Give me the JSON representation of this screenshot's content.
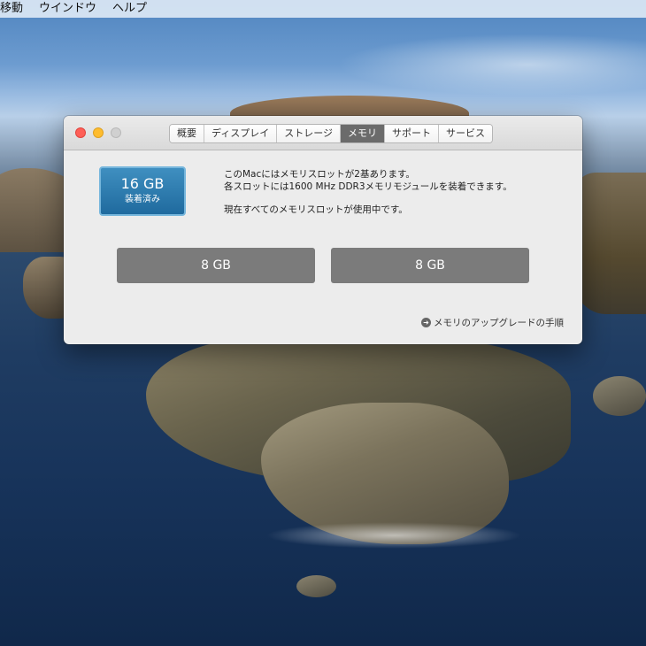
{
  "menubar": {
    "items": [
      "移動",
      "ウインドウ",
      "ヘルプ"
    ]
  },
  "window": {
    "tabs": [
      {
        "label": "概要",
        "active": false
      },
      {
        "label": "ディスプレイ",
        "active": false
      },
      {
        "label": "ストレージ",
        "active": false
      },
      {
        "label": "メモリ",
        "active": true
      },
      {
        "label": "サポート",
        "active": false
      },
      {
        "label": "サービス",
        "active": false
      }
    ],
    "memory": {
      "total": "16 GB",
      "status": "装着済み",
      "info_line1": "このMacにはメモリスロットが2基あります。",
      "info_line2": "各スロットには1600 MHz DDR3メモリモジュールを装着できます。",
      "info_line3": "現在すべてのメモリスロットが使用中です。",
      "slots": [
        "8 GB",
        "8 GB"
      ],
      "upgrade_link": "メモリのアップグレードの手順"
    }
  },
  "colors": {
    "badge_blue": "#1f6a9e",
    "slot_gray": "#7b7b7b",
    "active_tab": "#6b6b6b"
  }
}
